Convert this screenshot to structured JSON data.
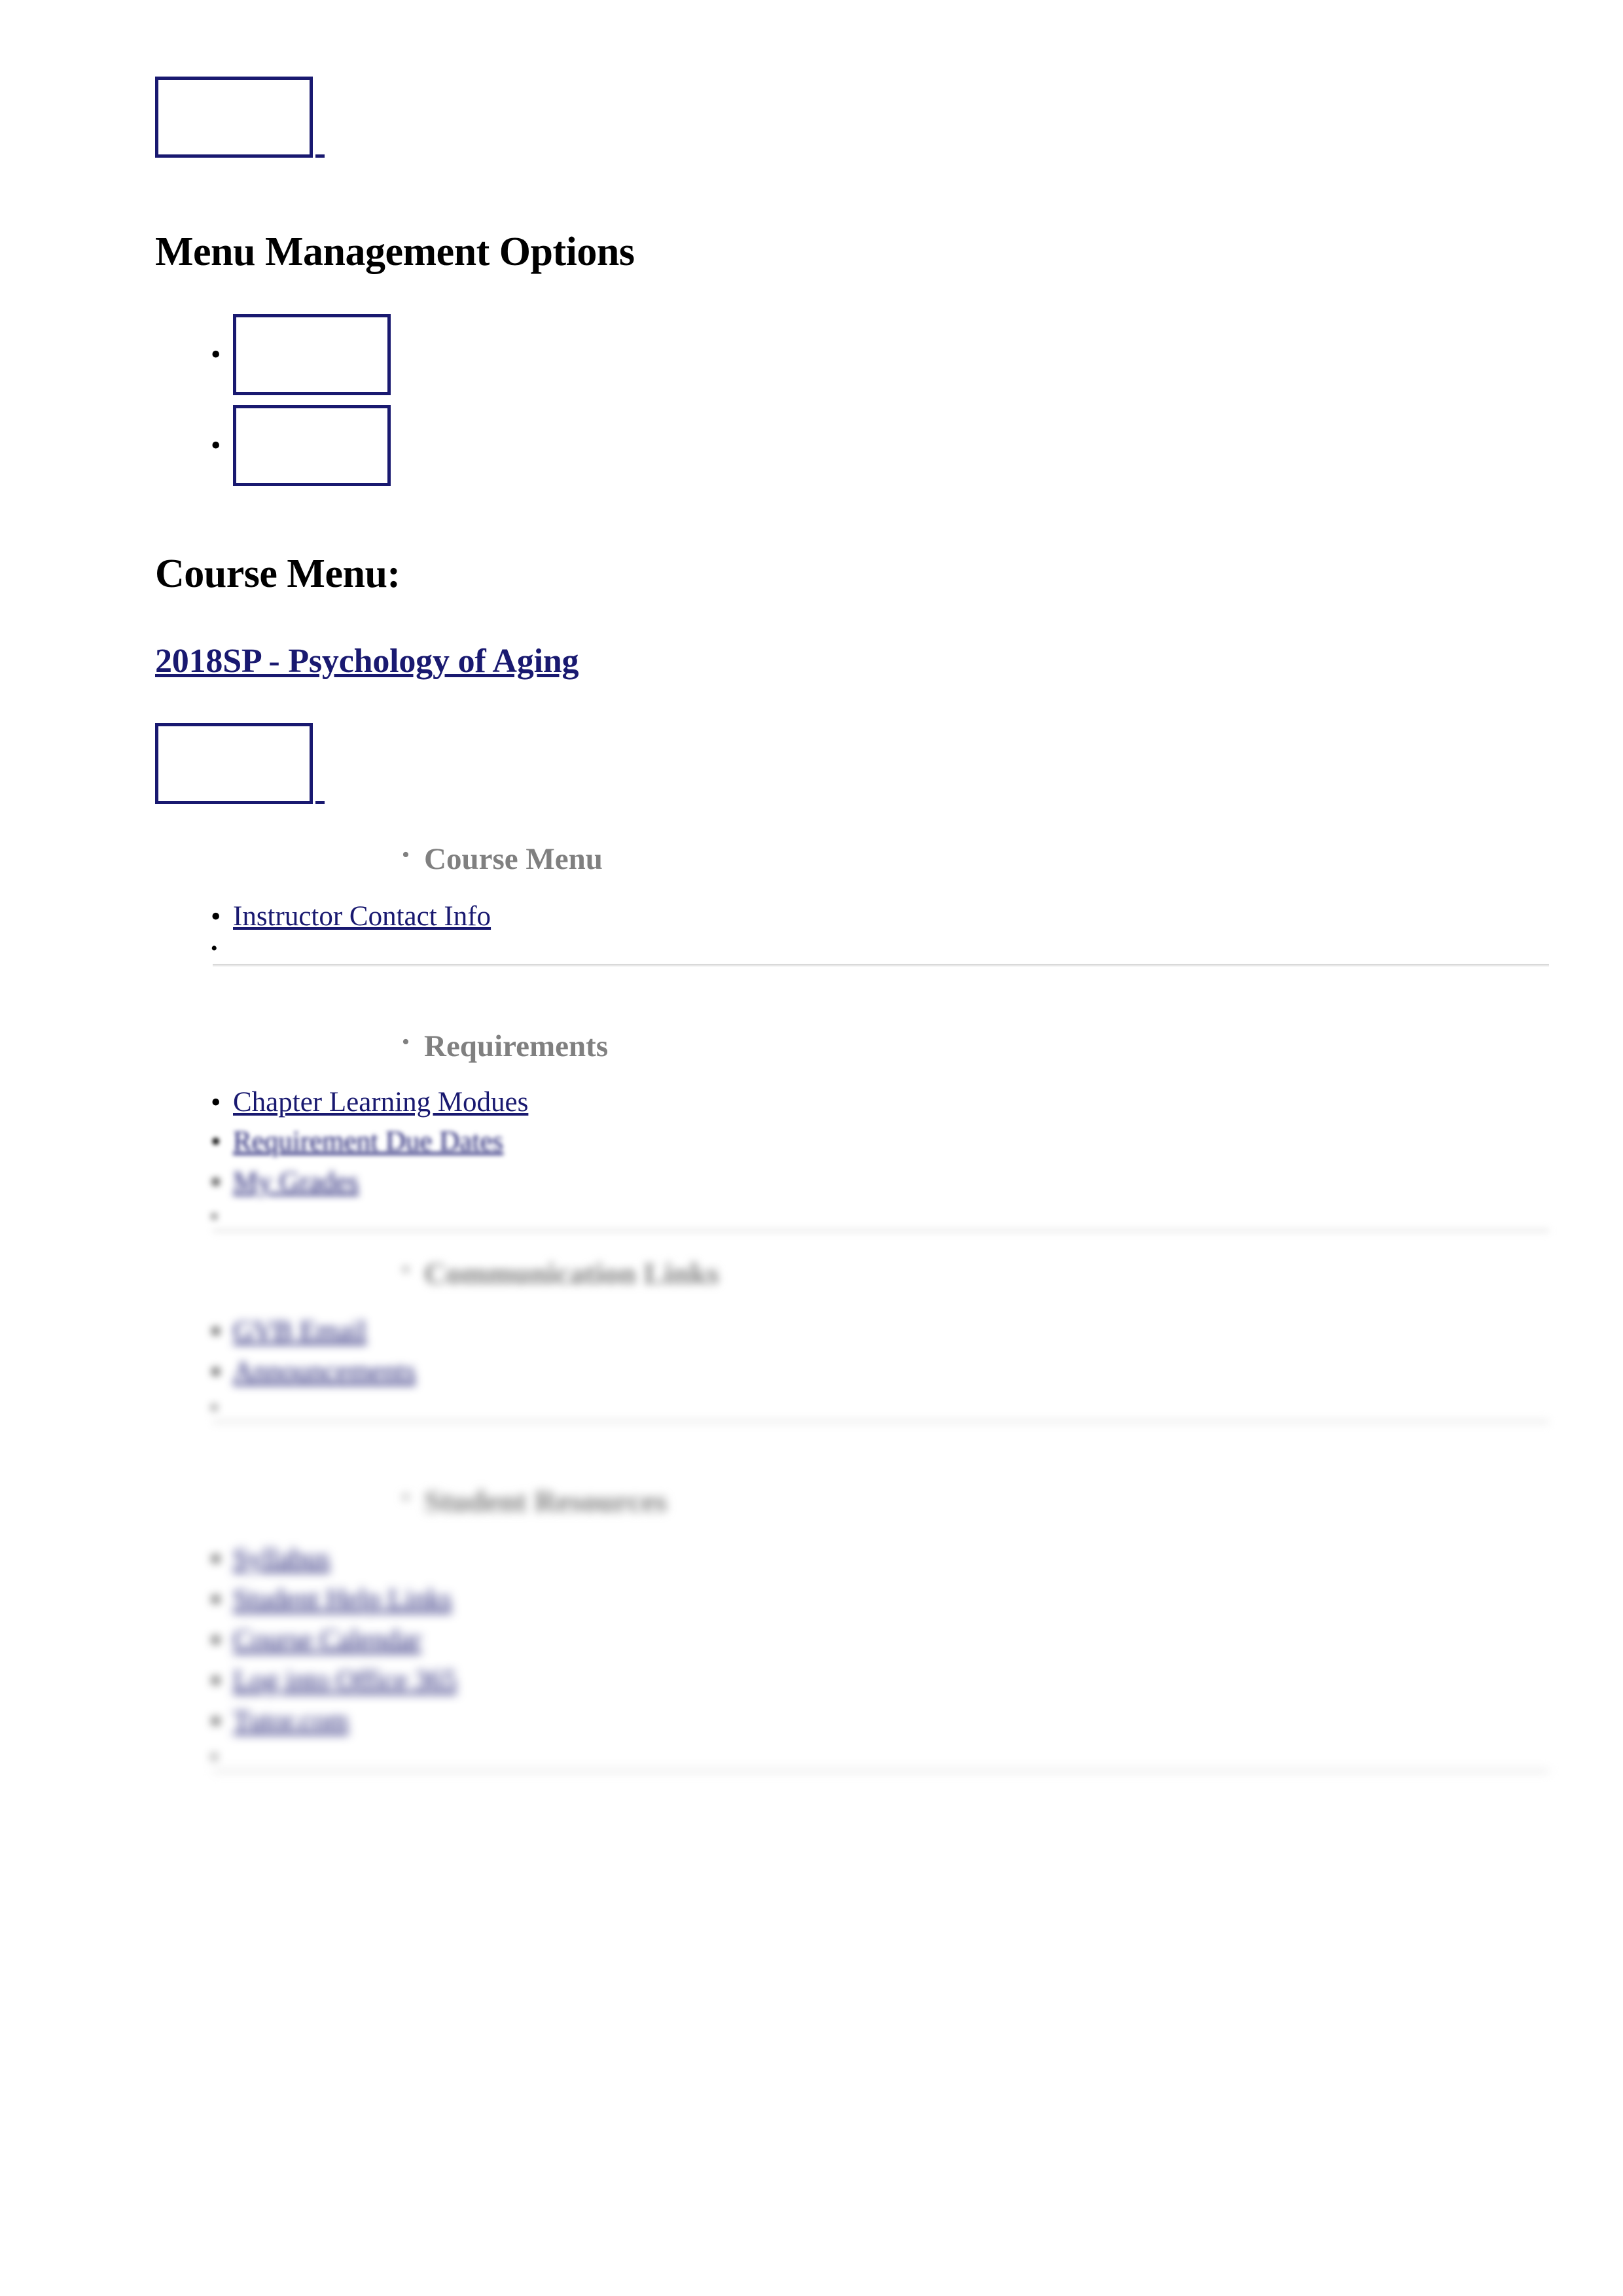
{
  "page": {
    "heading_menu_management": "Menu Management Options",
    "heading_course_menu": "Course Menu:",
    "course_link": "2018SP - Psychology of Aging"
  },
  "placeholders": {
    "top_logo_alt": "broken-image-placeholder",
    "menu_option_1_alt": "broken-image-placeholder",
    "menu_option_2_alt": "broken-image-placeholder",
    "course_banner_alt": "broken-image-placeholder"
  },
  "menu_groups": [
    {
      "title": "Course Menu",
      "items": [
        {
          "label": "Instructor Contact Info"
        },
        {
          "label": ""
        }
      ]
    },
    {
      "title": "Requirements",
      "items": [
        {
          "label": "Chapter Learning Modues"
        },
        {
          "label": "Requirement Due Dates"
        },
        {
          "label": "My Grades"
        },
        {
          "label": ""
        }
      ]
    },
    {
      "title": "Communication Links",
      "items": [
        {
          "label": "GVB Email"
        },
        {
          "label": "Announcements"
        },
        {
          "label": ""
        }
      ]
    },
    {
      "title": "Student Resources",
      "items": [
        {
          "label": "Syllabus"
        },
        {
          "label": "Student Help Links"
        },
        {
          "label": "Course Calendar"
        },
        {
          "label": "Log into Office 365"
        },
        {
          "label": "Tutor.com"
        },
        {
          "label": ""
        }
      ]
    }
  ],
  "colors": {
    "link": "#191970",
    "group_heading": "#808080",
    "rule": "#d9d9d9",
    "text": "#000000",
    "background": "#ffffff"
  },
  "bullets": {
    "item_glyph": "•",
    "group_glyph": "•"
  }
}
